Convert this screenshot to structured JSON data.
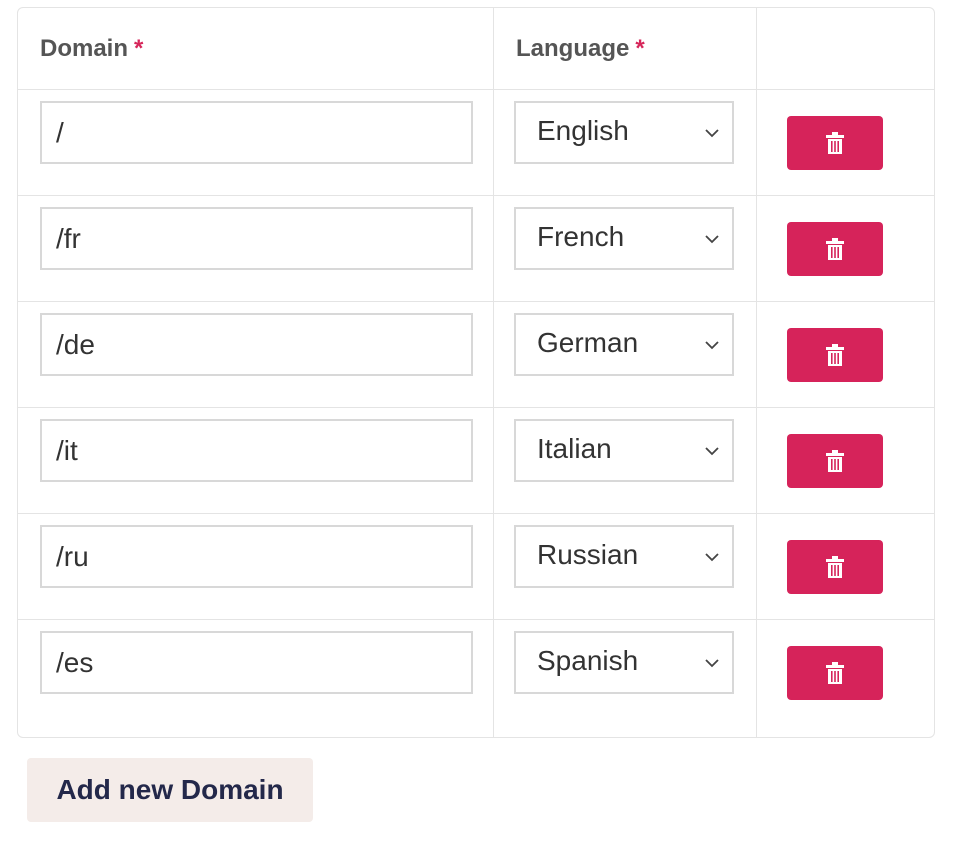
{
  "table": {
    "headers": {
      "domain": "Domain",
      "language": "Language",
      "required_mark": "*"
    },
    "rows": [
      {
        "domain": "/",
        "language": "English"
      },
      {
        "domain": "/fr",
        "language": "French"
      },
      {
        "domain": "/de",
        "language": "German"
      },
      {
        "domain": "/it",
        "language": "Italian"
      },
      {
        "domain": "/ru",
        "language": "Russian"
      },
      {
        "domain": "/es",
        "language": "Spanish"
      }
    ],
    "delete_icon": "trash-icon"
  },
  "add_button": {
    "label": "Add new Domain"
  },
  "colors": {
    "danger": "#d6235a",
    "required": "#d6265a",
    "add_button_bg": "#f4ece9",
    "add_button_text": "#23284a"
  }
}
